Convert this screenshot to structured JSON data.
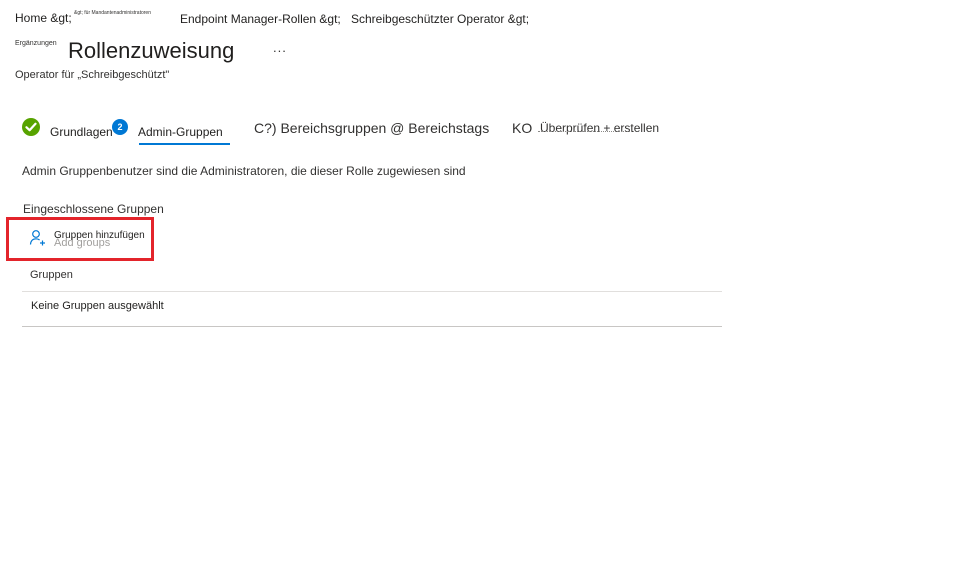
{
  "breadcrumb": {
    "home": "Home &gt;",
    "tenant_admin": "&gt; für Mandantenadministratoren",
    "roles": "Endpoint Manager-Rollen &gt;",
    "operator": "Schreibgeschützter Operator &gt;"
  },
  "header": {
    "supplements": "Ergänzungen",
    "title": "Rollenzuweisung",
    "more": "...",
    "subtitle": "Operator für „Schreibgeschützt\""
  },
  "wizard": {
    "steps": [
      {
        "label": "Grundlagen",
        "state": "done"
      },
      {
        "number": "2",
        "label": "Admin-Gruppen",
        "state": "active"
      },
      {
        "label": "C?) Bereichsgruppen @ Bereichstags",
        "state": "pending"
      },
      {
        "prefix": "KO",
        "label": "Überprüfen + erstellen",
        "state": "pending"
      }
    ]
  },
  "main": {
    "description": "Admin Gruppenbenutzer sind die Administratoren, die dieser Rolle zugewiesen sind",
    "included_label": "Eingeschlossene Gruppen",
    "add_groups_label": "Gruppen hinzufügen",
    "add_groups_ghost": "Add groups",
    "table": {
      "column": "Gruppen",
      "empty": "Keine Gruppen ausgewählt"
    }
  },
  "colors": {
    "accent": "#0078d4",
    "success": "#57a300",
    "highlight": "#e3242b"
  },
  "icons": {
    "step_done": "checkmark-circle-icon",
    "add_groups": "add-person-icon"
  }
}
